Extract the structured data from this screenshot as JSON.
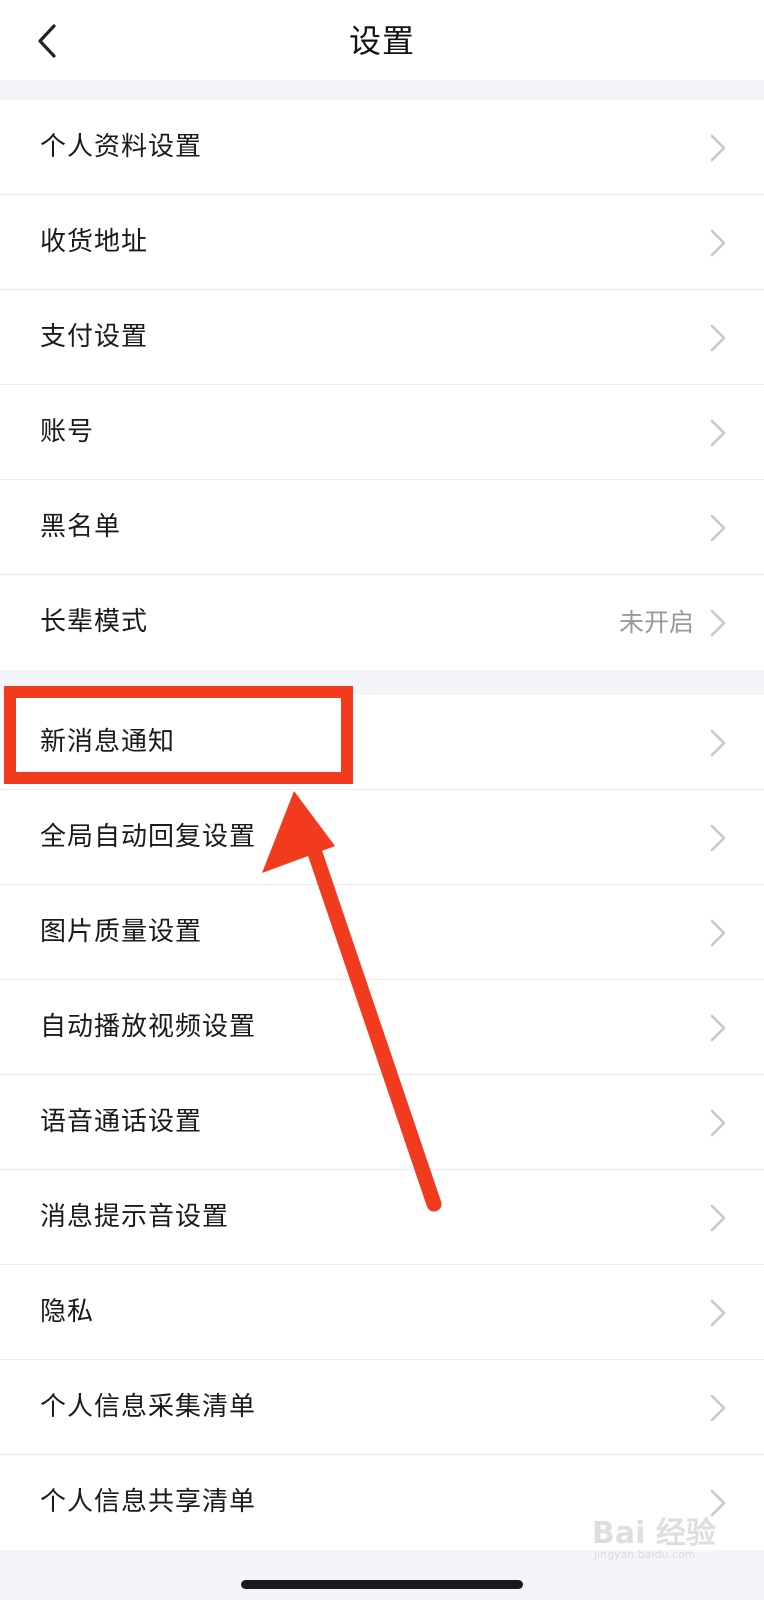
{
  "header": {
    "title": "设置",
    "back_icon": "chevron-left-icon"
  },
  "group1": {
    "items": [
      {
        "label": "个人资料设置"
      },
      {
        "label": "收货地址"
      },
      {
        "label": "支付设置"
      },
      {
        "label": "账号"
      },
      {
        "label": "黑名单"
      },
      {
        "label": "长辈模式",
        "value": "未开启"
      }
    ]
  },
  "group2": {
    "items": [
      {
        "label": "新消息通知"
      },
      {
        "label": "全局自动回复设置"
      },
      {
        "label": "图片质量设置"
      },
      {
        "label": "自动播放视频设置"
      },
      {
        "label": "语音通话设置"
      },
      {
        "label": "消息提示音设置"
      },
      {
        "label": "隐私"
      },
      {
        "label": "个人信息采集清单"
      },
      {
        "label": "个人信息共享清单"
      }
    ]
  },
  "annotation": {
    "color": "#f23a1f"
  },
  "watermark": {
    "text": "Bai 经验",
    "url": "jingyan.baidu.com"
  },
  "colors": {
    "background": "#f4f5f8",
    "row_background": "#ffffff",
    "chevron": "#c7c7cc",
    "secondary_text": "#999999"
  }
}
